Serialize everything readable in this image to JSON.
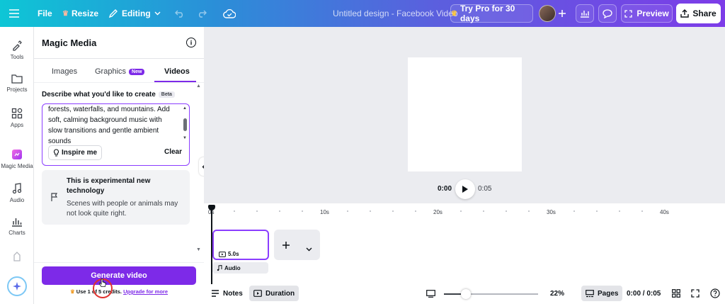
{
  "topbar": {
    "file": "File",
    "resize": "Resize",
    "editing": "Editing",
    "doc_title": "Untitled design - Facebook Video",
    "try_pro": "Try Pro for 30 days",
    "preview": "Preview",
    "share": "Share"
  },
  "rail": {
    "items": [
      {
        "label": "Tools"
      },
      {
        "label": "Projects"
      },
      {
        "label": "Apps"
      },
      {
        "label": "Magic Media"
      },
      {
        "label": "Audio"
      },
      {
        "label": "Charts"
      }
    ]
  },
  "panel": {
    "title": "Magic Media",
    "info": "i",
    "tabs": [
      {
        "label": "Images"
      },
      {
        "label": "Graphics",
        "badge": "New"
      },
      {
        "label": "Videos"
      }
    ],
    "prompt_label": "Describe what you'd like to create",
    "prompt_badge": "Beta",
    "prompt_text": "forests, waterfalls, and mountains. Add soft, calming background music with slow transitions and gentle ambient sounds",
    "inspire": "Inspire me",
    "clear": "Clear",
    "notice_title": "This is experimental new technology",
    "notice_body": "Scenes with people or animals may not look quite right.",
    "generate": "Generate video",
    "credits_prefix": "Use 1 of 5 credits.",
    "credits_link": "Upgrade for more"
  },
  "player": {
    "current_time": "0:00",
    "duration": "0:05"
  },
  "timeline": {
    "ticks": [
      "0s",
      "10s",
      "20s",
      "30s",
      "40s"
    ],
    "clip_duration": "5.0s",
    "audio_label": "Audio"
  },
  "bottombar": {
    "notes": "Notes",
    "duration": "Duration",
    "zoom": "22%",
    "zoom_level": 0.23,
    "pages": "Pages",
    "time": "0:00 / 0:05"
  },
  "colors": {
    "accent": "#7d2ae8",
    "gradient_start": "#0ec6d6",
    "gradient_end": "#7d3ce8"
  }
}
